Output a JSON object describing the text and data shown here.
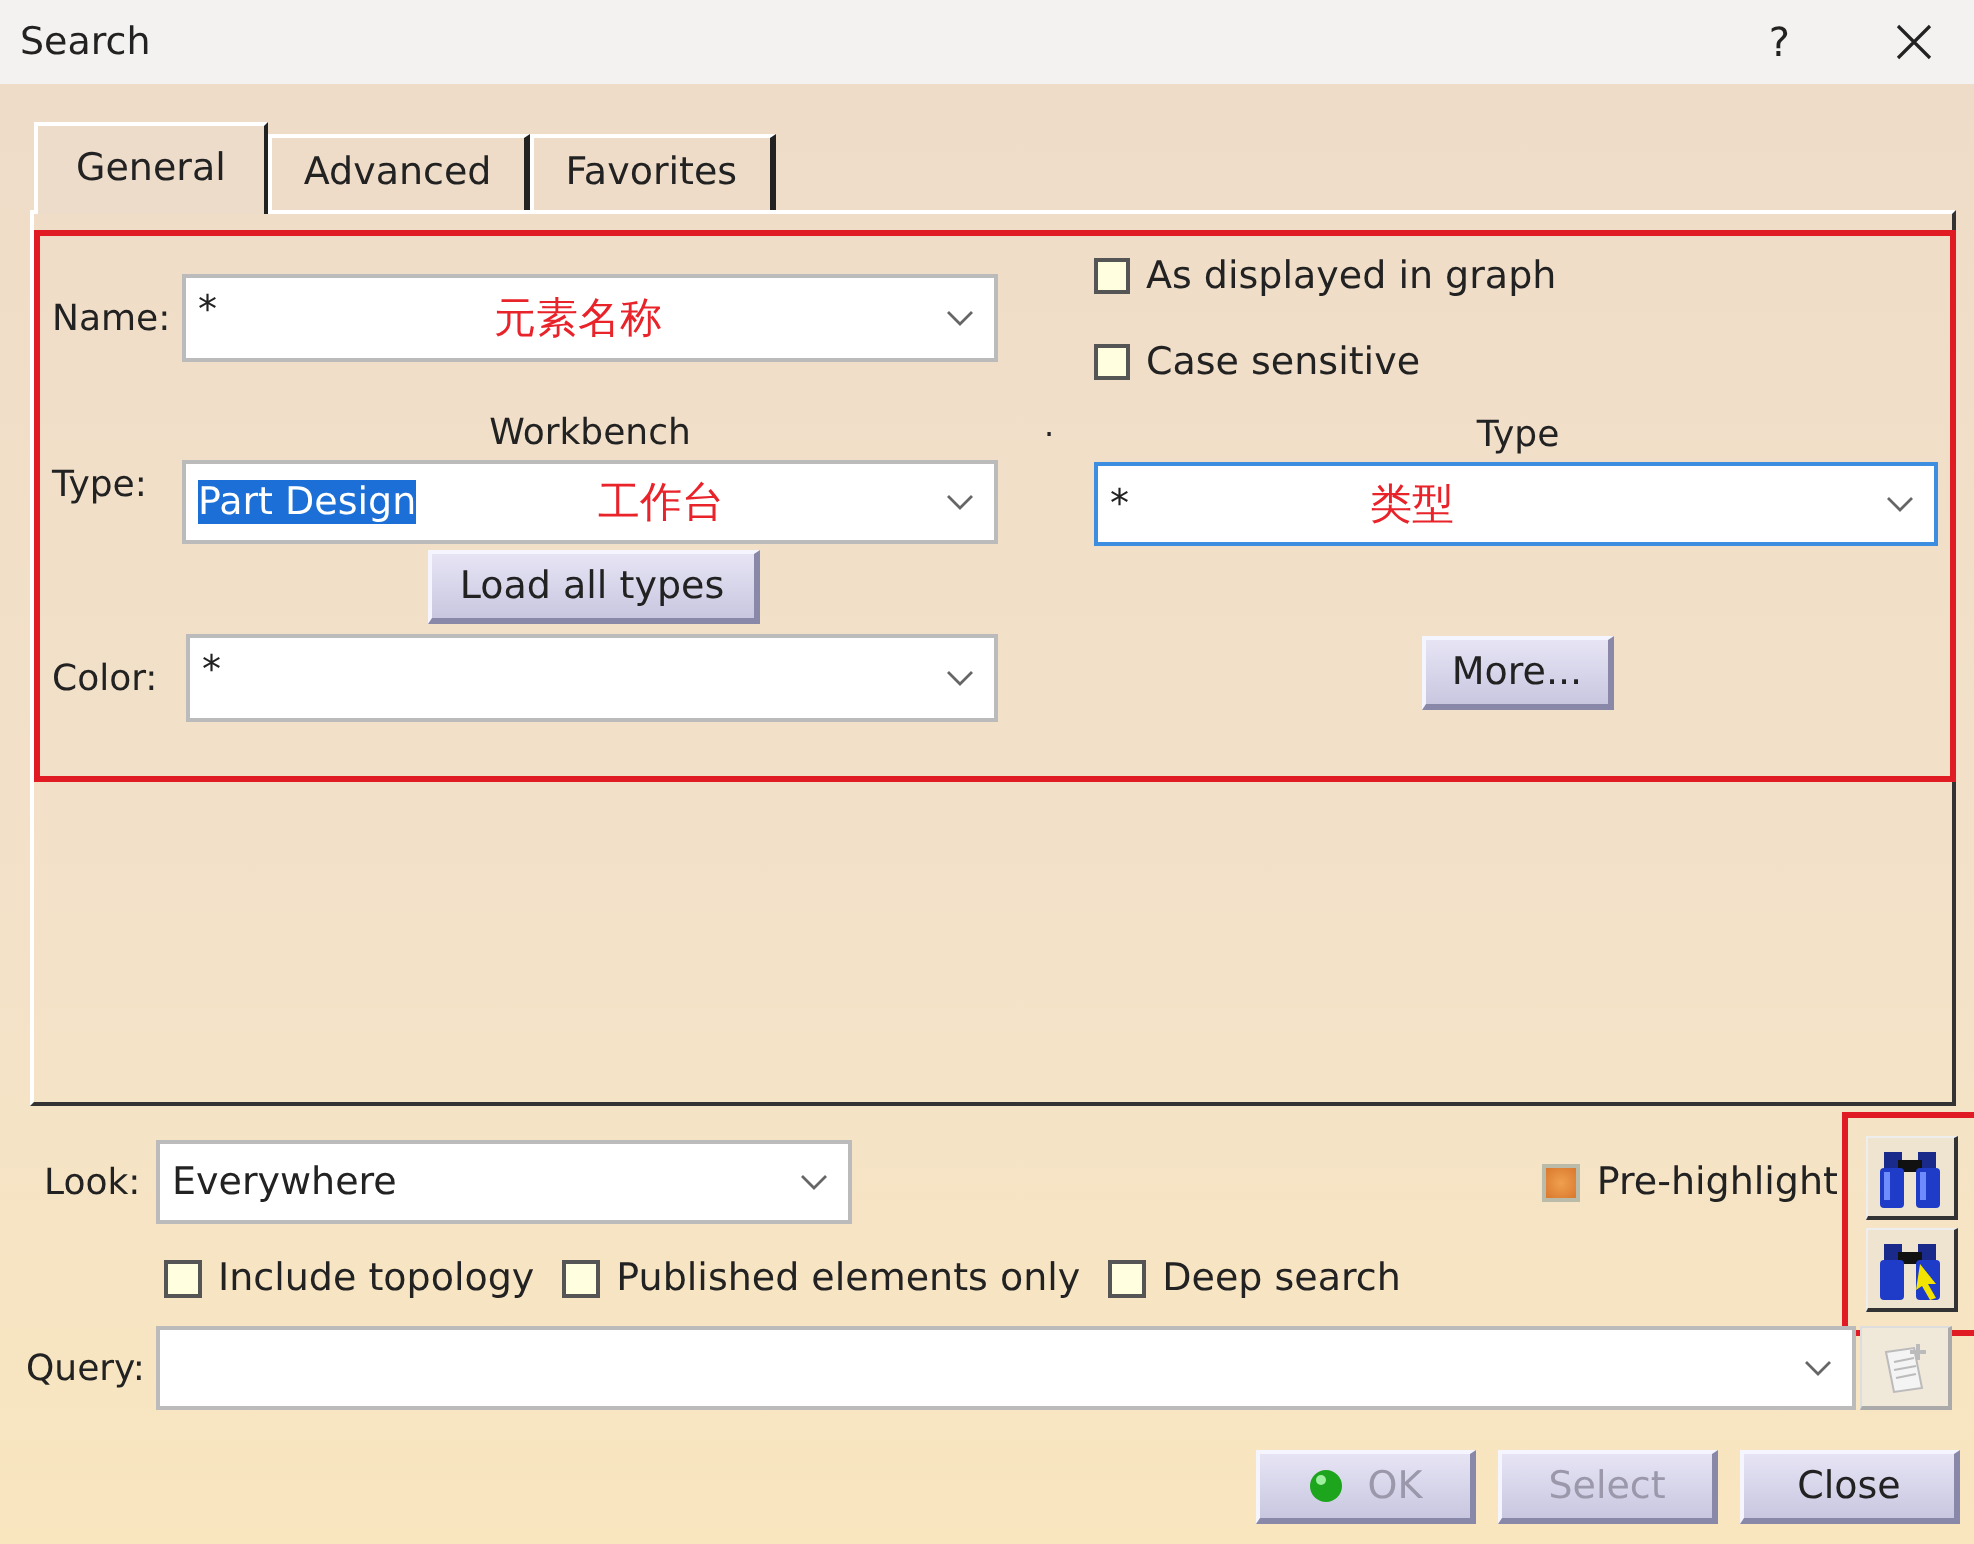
{
  "window": {
    "title": "Search",
    "help": "?"
  },
  "tabs": [
    {
      "label": "General",
      "selected": true
    },
    {
      "label": "Advanced",
      "selected": false
    },
    {
      "label": "Favorites",
      "selected": false
    }
  ],
  "general": {
    "name": {
      "label": "Name:",
      "value": "*",
      "note": "元素名称",
      "focused": false,
      "highlighted": false
    },
    "checkboxes": [
      {
        "label": "As displayed in graph",
        "checked": false
      },
      {
        "label": "Case sensitive",
        "checked": false
      }
    ],
    "workbench_heading": "Workbench",
    "separator": ".",
    "type_heading": "Type",
    "type": {
      "label": "Type:",
      "value": "Part Design",
      "note": "工作台",
      "focused": false,
      "highlighted": true
    },
    "load_all_types": "Load all types",
    "type_field": {
      "value": "*",
      "note": "类型",
      "focused": true,
      "highlighted": false
    },
    "color": {
      "label": "Color:",
      "value": "*",
      "focused": false,
      "highlighted": false
    },
    "more": "More..."
  },
  "look": {
    "label": "Look:",
    "value": "Everywhere"
  },
  "pre_highlight": {
    "label": "Pre-highlight",
    "checked": true
  },
  "options": [
    {
      "label": "Include topology",
      "checked": false
    },
    {
      "label": "Published elements only",
      "checked": false
    },
    {
      "label": "Deep search",
      "checked": false
    }
  ],
  "query": {
    "label": "Query:"
  },
  "buttons": [
    {
      "label": "OK",
      "kind": "ok",
      "disabled": true
    },
    {
      "label": "Select",
      "kind": "plain",
      "disabled": true
    },
    {
      "label": "Close",
      "kind": "plain",
      "disabled": false
    }
  ]
}
